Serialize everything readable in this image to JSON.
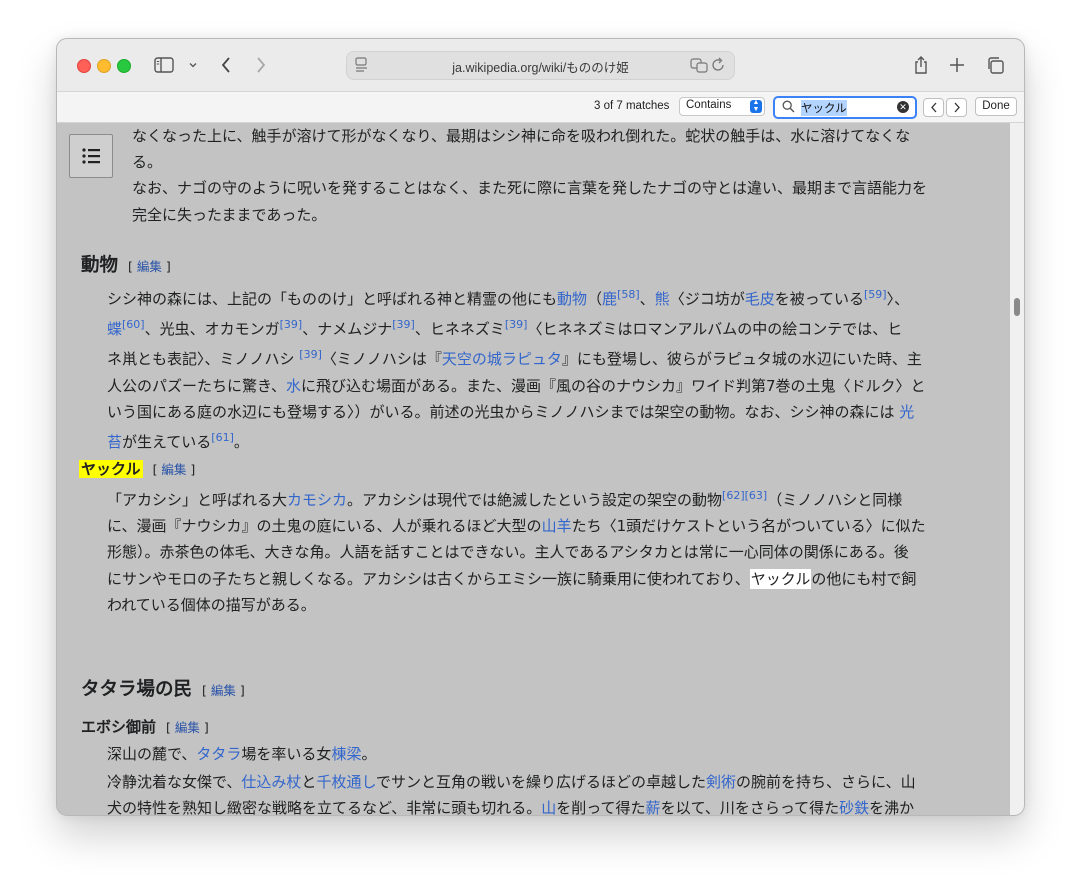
{
  "browser": {
    "url": "ja.wikipedia.org/wiki/もののけ姫"
  },
  "find": {
    "match_count": "3 of 7 matches",
    "mode": "Contains",
    "query": "ヤックル",
    "done_label": "Done"
  },
  "article": {
    "top_line1": "なくなった上に、触手が溶けて形がなくなり、最期はシシ神に命を吸われ倒れた。蛇状の触手は、水に溶けてなくな",
    "top_line2": "る。",
    "top_line3": "なお、ナゴの守のように呪いを発することはなく、また死に際に言葉を発したナゴの守とは違い、最期まで言語能力を",
    "top_line4": "完全に失ったままであった。",
    "animals_heading": "動物",
    "yakkuru_heading": "ヤックル",
    "tatara_heading": "タタラ場の民",
    "eboshi_heading": "エボシ御前",
    "edit_label": "編集",
    "eboshi_line1": "深山の麓で、タタラ場を率いる女棟梁。"
  }
}
